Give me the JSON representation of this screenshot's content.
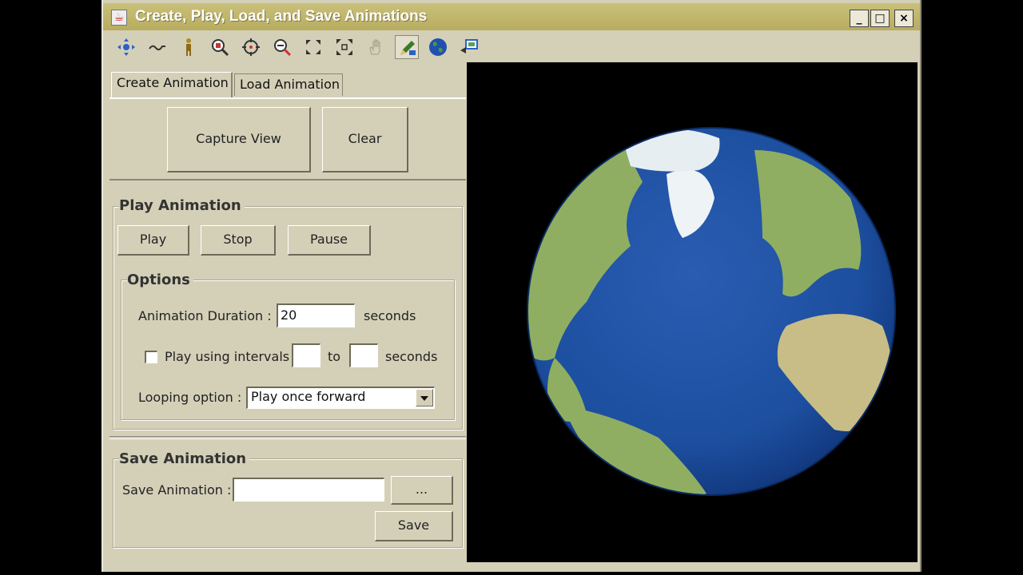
{
  "window": {
    "title": "Create, Play, Load, and Save Animations",
    "controls": {
      "minimize": "_",
      "maximize": "□",
      "close": "×"
    }
  },
  "toolbar": {
    "tools": [
      "pan-icon",
      "trail-icon",
      "person-icon",
      "zoom-region-icon",
      "target-icon",
      "zoom-out-icon",
      "fit-icon",
      "full-extent-icon",
      "hand-icon",
      "pencil-icon",
      "globe-icon",
      "screen-icon"
    ],
    "selected": "pencil-icon"
  },
  "tabs": [
    {
      "label": "Create Animation",
      "active": true
    },
    {
      "label": "Load Animation",
      "active": false
    }
  ],
  "create": {
    "capture_label": "Capture View",
    "clear_label": "Clear"
  },
  "play": {
    "group_title": "Play Animation",
    "play_label": "Play",
    "stop_label": "Stop",
    "pause_label": "Pause"
  },
  "options": {
    "group_title": "Options",
    "duration_label": "Animation Duration :",
    "duration_value": "20",
    "duration_unit": "seconds",
    "intervals_label": "Play using intervals",
    "intervals_checked": false,
    "intervals_from": "",
    "intervals_to_label": "to",
    "intervals_to": "",
    "intervals_unit": "seconds",
    "looping_label": "Looping option :",
    "looping_value": "Play once forward"
  },
  "save": {
    "group_title": "Save Animation",
    "field_label": "Save Animation :",
    "field_value": "",
    "browse_label": "...",
    "save_label": "Save"
  },
  "colors": {
    "ocean": "#1d4fa0",
    "land": "#8fae62",
    "ice": "#eef3f5",
    "window": "#d4d0b8",
    "title": "#bdb265"
  }
}
